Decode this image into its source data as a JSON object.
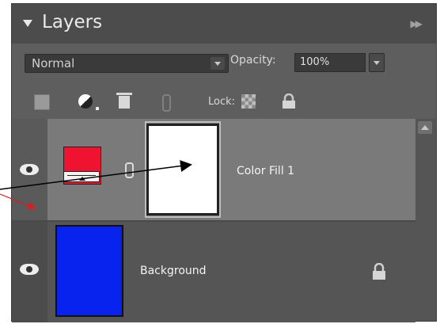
{
  "panel": {
    "title": "Layers",
    "collapse_icon": "double-chevron-right-icon"
  },
  "toolbar": {
    "blend_mode": "Normal",
    "opacity_label": "Opacity:",
    "opacity_value": "100%",
    "lock_label": "Lock:"
  },
  "layers": [
    {
      "name": "Color Fill 1",
      "visible": true,
      "fill_color": "#ef1331",
      "has_mask": true,
      "selected": true
    },
    {
      "name": "Background",
      "visible": true,
      "fill_color": "#0823ee",
      "locked": true,
      "selected": false
    }
  ],
  "annotations": {
    "black_arrow_color": "#000000",
    "red_arrow_color": "#e01b1b"
  },
  "icons": [
    "new-layer-icon",
    "adjustment-layer-icon",
    "trash-icon",
    "link-icon",
    "lock-transparency-icon",
    "lock-all-icon",
    "eye-icon",
    "chain-icon",
    "lock-icon"
  ]
}
